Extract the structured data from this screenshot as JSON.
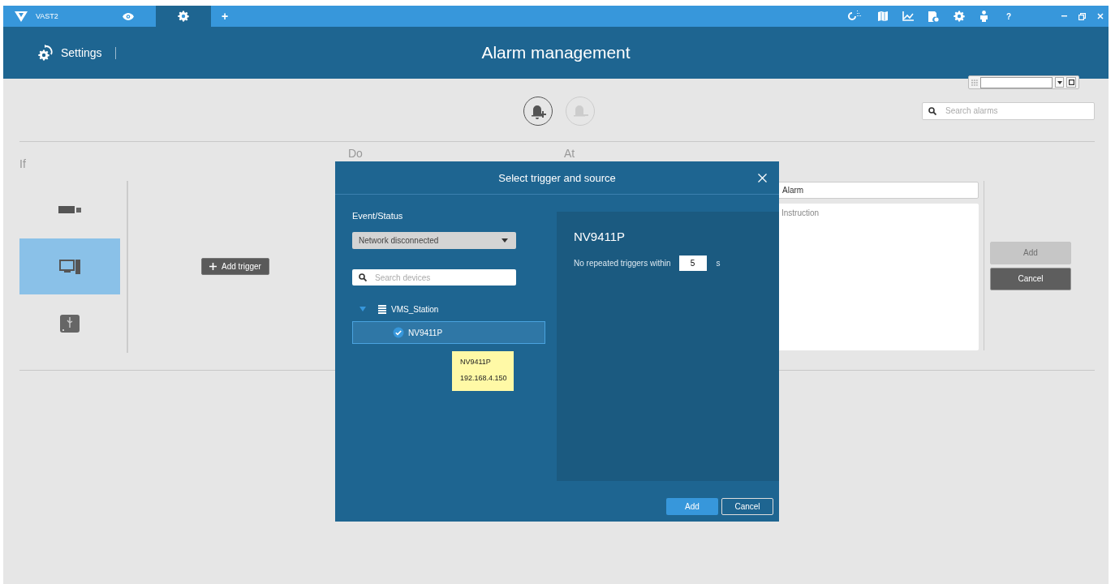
{
  "app_bar": {
    "logo": "VAST2",
    "tabs": [
      {
        "kind": "view",
        "selected": false
      },
      {
        "kind": "settings",
        "selected": true
      }
    ],
    "new_tab": "+",
    "help": "?"
  },
  "header": {
    "back_label": "Settings",
    "title": "Alarm management"
  },
  "toolbar": {
    "add_alarm": {
      "disabled": false
    },
    "remove_alarm": {
      "disabled": true
    },
    "search": {
      "placeholder": "Search alarms"
    }
  },
  "sections": {
    "if_label": "If",
    "do_label": "Do",
    "at_label": "At"
  },
  "source_types": [
    {
      "kind": "camera",
      "selected": false
    },
    {
      "kind": "computer",
      "selected": true
    },
    {
      "kind": "usb",
      "selected": false
    }
  ],
  "add_trigger": "Add trigger",
  "alarm_form": {
    "name_value": "Alarm",
    "instruction_placeholder": "Instruction",
    "buttons": [
      {
        "label": "Add",
        "disabled": true
      },
      {
        "label": "Cancel",
        "disabled": false
      }
    ]
  },
  "dialog": {
    "title": "Select trigger and source",
    "event_label": "Event/Status",
    "event_value": "Network disconnected",
    "search": {
      "placeholder": "Search devices"
    },
    "tree": [
      {
        "label": "VMS_Station",
        "expanded": true,
        "children": [
          {
            "label": "NV9411P",
            "checked": true,
            "selected": true
          }
        ]
      }
    ],
    "tooltip": [
      "NV9411P",
      "192.168.4.150"
    ],
    "detail": {
      "title": "NV9411P",
      "repeat_label": "No repeated triggers within",
      "repeat_value": "5",
      "unit": "s"
    },
    "buttons": [
      {
        "label": "Add",
        "kind": "primary"
      },
      {
        "label": "Cancel",
        "kind": "secondary"
      }
    ]
  }
}
